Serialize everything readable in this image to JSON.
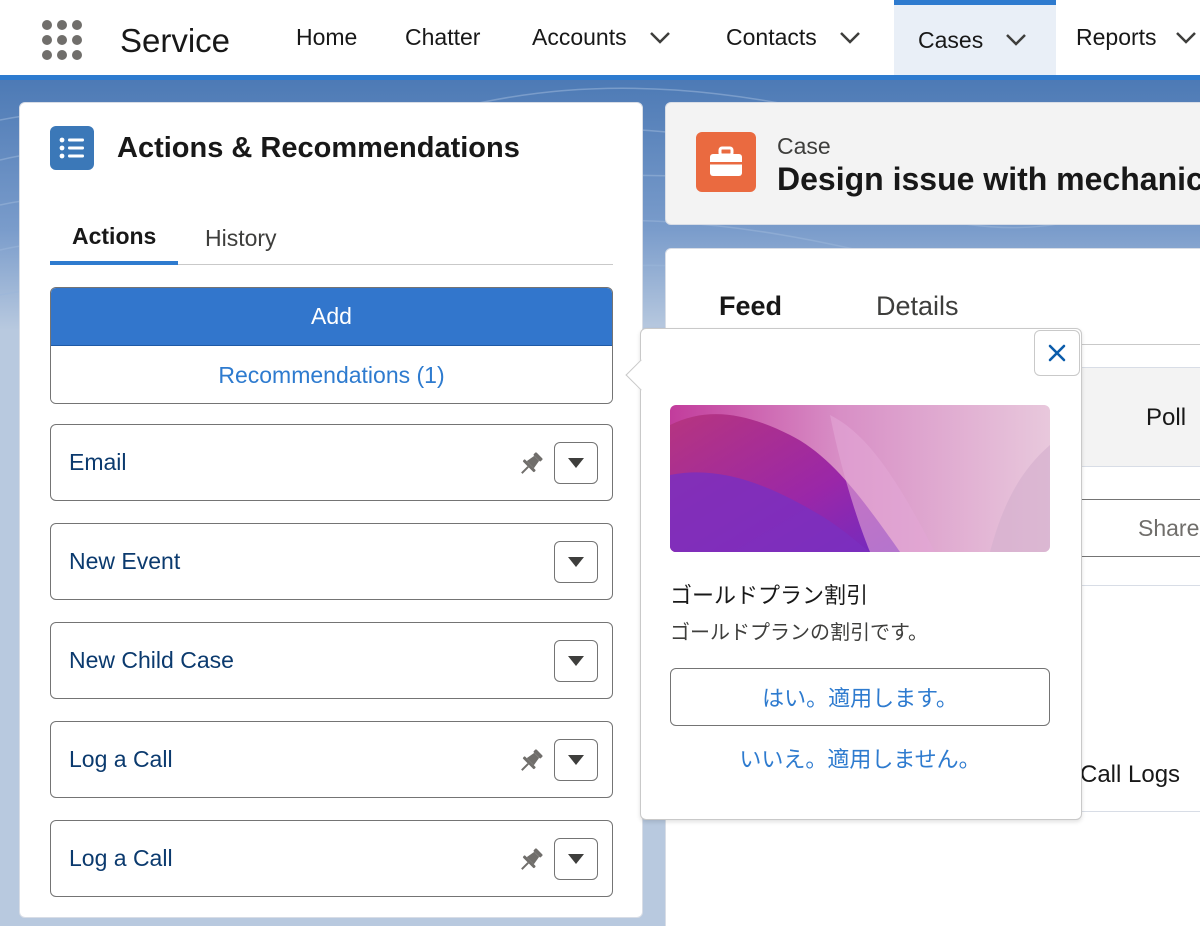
{
  "app": {
    "name": "Service"
  },
  "nav": {
    "items": [
      {
        "label": "Home"
      },
      {
        "label": "Chatter"
      },
      {
        "label": "Accounts"
      },
      {
        "label": "Contacts"
      },
      {
        "label": "Cases"
      },
      {
        "label": "Reports"
      }
    ],
    "active": "Cases"
  },
  "panel": {
    "title": "Actions & Recommendations",
    "tabs": [
      {
        "label": "Actions"
      },
      {
        "label": "History"
      }
    ],
    "add_label": "Add",
    "recommendations_label": "Recommendations (1)",
    "actions": [
      {
        "label": "Email",
        "pinned": true
      },
      {
        "label": "New Event",
        "pinned": false
      },
      {
        "label": "New Child Case",
        "pinned": false
      },
      {
        "label": "Log a Call",
        "pinned": true
      },
      {
        "label": "Log a Call",
        "pinned": true
      }
    ]
  },
  "case": {
    "object_label": "Case",
    "title": "Design issue with mechanic"
  },
  "feed": {
    "tabs": [
      {
        "label": "Feed"
      },
      {
        "label": "Details"
      }
    ],
    "poll_label": "Poll",
    "share_label": "Share",
    "call_logs_label": "Call Logs"
  },
  "popover": {
    "title": "ゴールドプラン割引",
    "description": "ゴールドプランの割引です。",
    "accept_label": "はい。適用します。",
    "reject_label": "いいえ。適用しません。"
  },
  "colors": {
    "brand": "#2e7bcf",
    "case_icon": "#ea6a40",
    "panel_icon": "#3b78b8"
  }
}
